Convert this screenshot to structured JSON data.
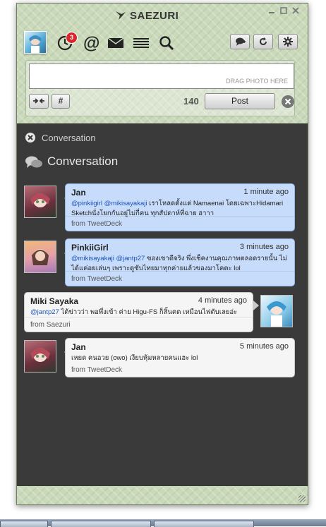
{
  "app": {
    "title": "SAEZURI"
  },
  "toolbar": {
    "icons": [
      "timeline-icon",
      "mentions-icon",
      "messages-icon",
      "lists-icon",
      "search-icon"
    ],
    "timeline_badge": "3",
    "right_buttons": [
      "new-column-icon",
      "refresh-icon",
      "settings-icon"
    ]
  },
  "compose": {
    "text": "",
    "drag_hint": "DRAG PHOTO HERE",
    "shorten_label": "→←",
    "hashtag_label": "#",
    "char_count": "140",
    "post_label": "Post"
  },
  "panel": {
    "small_title": "Conversation",
    "title": "Conversation"
  },
  "tweets": [
    {
      "name": "Jan",
      "time": "1 minute ago",
      "mentions": "@pinkiigirl @mikisayakaji",
      "text": " เราโหลดตั้งแต่ Namaenai โดยเฉพาะHidamari Sketchนั่งโยกกันอยู่ไม่กี่คน ทุกสัปดาห์ที่ฉาย ฮาาา",
      "source": "from TweetDeck",
      "style": "blue"
    },
    {
      "name": "PinkiiGirl",
      "time": "3 minutes ago",
      "mentions": "@mikisayakaji @jantp27",
      "text": " ของเขาดีจริง พึ่งเช็คงานคุณภาพตลอดรายนั้น ไม่ได้แค่อยเล่นๆ เพราะดูซับไทยมาทุกค่ายแล้วของมาโคตะ lol",
      "source": "from TweetDeck",
      "style": "blue"
    },
    {
      "name": "Miki Sayaka",
      "time": "4 minutes ago",
      "mentions": "@jantp27",
      "text": " ได้ข่าวว่า พอพึ่งเข้า ค่าย Higu-FS ก็สิ้นคด เหมือนไฟดับเลยอ่ะ",
      "source": "from Saezuri",
      "style": "white"
    },
    {
      "name": "Jan",
      "time": "5 minutes ago",
      "mentions": "",
      "text": "เหยด คนอวย (owo) เงียบหุ้มหลายคนแฮะ lol",
      "source": "from TweetDeck",
      "style": "white"
    }
  ],
  "colors": {
    "header_green": "#c9d9ba",
    "panel_dark": "#3a3a3a",
    "tweet_blue": "#c7dcfb",
    "badge_red": "#d9262b",
    "mention_blue": "#1e55b8"
  }
}
